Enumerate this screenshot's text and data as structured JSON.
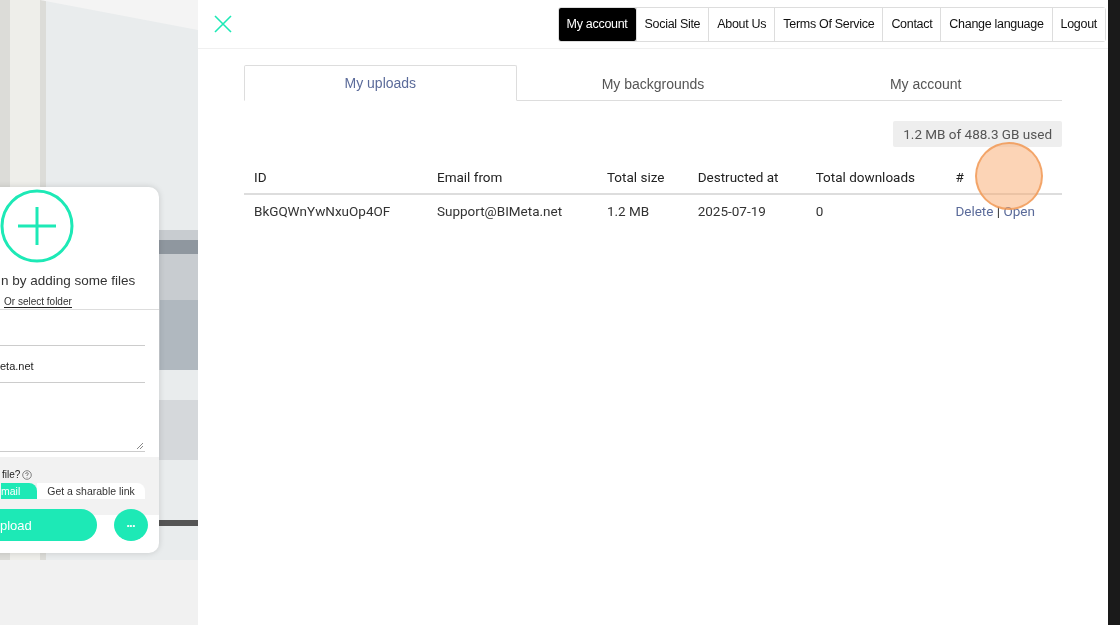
{
  "upload_card": {
    "prompt": "n by adding some files",
    "select_folder": "Or select folder",
    "email_value": "eta.net",
    "question": "file?",
    "share_options": [
      {
        "label": "mail",
        "selected": true
      },
      {
        "label": "Get a sharable link",
        "selected": false
      }
    ],
    "upload_button": "pload",
    "more_button": "•••"
  },
  "nav": [
    {
      "label": "My account",
      "selected": true
    },
    {
      "label": "Social Site",
      "selected": false
    },
    {
      "label": "About Us",
      "selected": false
    },
    {
      "label": "Terms Of Service",
      "selected": false
    },
    {
      "label": "Contact",
      "selected": false
    },
    {
      "label": "Change language",
      "selected": false
    },
    {
      "label": "Logout",
      "selected": false
    }
  ],
  "tabs": [
    {
      "label": "My uploads",
      "selected": true
    },
    {
      "label": "My backgrounds",
      "selected": false
    },
    {
      "label": "My account",
      "selected": false
    }
  ],
  "usage": "1.2 MB of 488.3 GB used",
  "table": {
    "columns": [
      "ID",
      "Email from",
      "Total size",
      "Destructed at",
      "Total downloads",
      "#"
    ],
    "rows": [
      {
        "cells": [
          "BkGQWnYwNxuOp4OF",
          "Support@BIMeta.net",
          "1.2 MB",
          "2025-07-19",
          "0"
        ],
        "actions": [
          "Delete",
          "Open"
        ],
        "separator": "|"
      }
    ]
  }
}
